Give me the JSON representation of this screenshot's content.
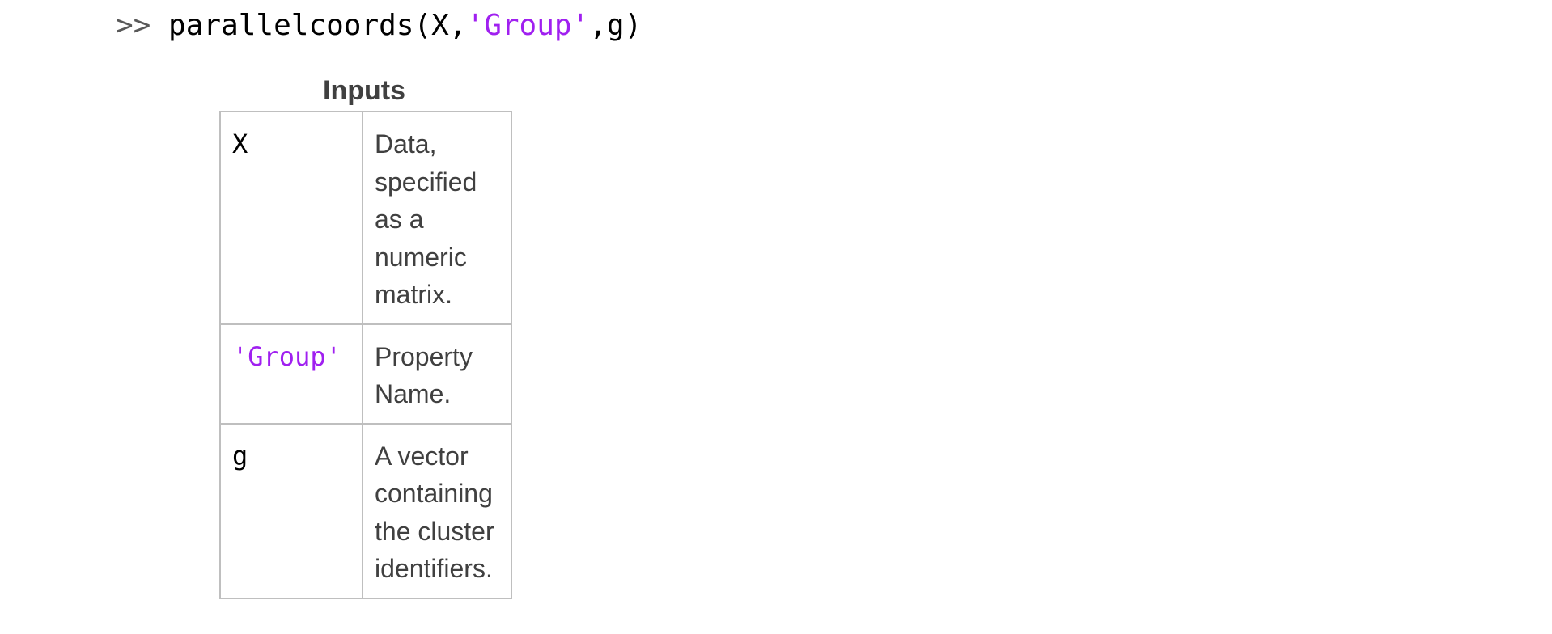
{
  "command": {
    "prompt": ">>",
    "func": "parallelcoords(X,",
    "string_arg": "'Group'",
    "tail": ",g)"
  },
  "table": {
    "caption": "Inputs",
    "rows": [
      {
        "arg": "X",
        "desc": "Data, specified as a numeric matrix."
      },
      {
        "arg": "'Group'",
        "desc": "Property Name."
      },
      {
        "arg": "g",
        "desc": "A vector containing the cluster identifiers."
      }
    ]
  },
  "colors": {
    "string": "#a020f0",
    "text": "#404040",
    "border": "#bfbfbf"
  }
}
